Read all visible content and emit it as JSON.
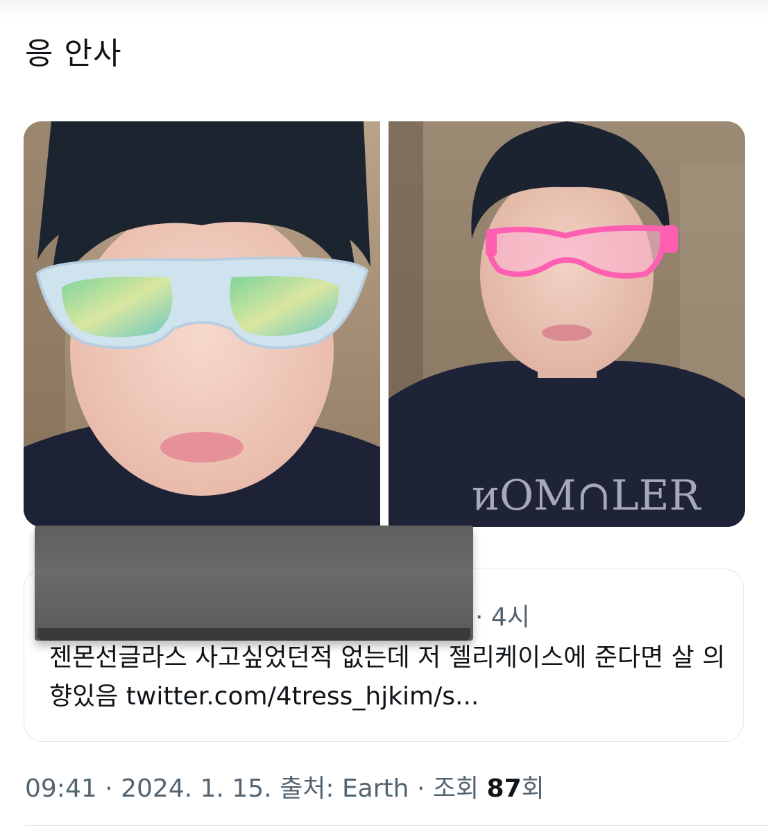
{
  "tweet": {
    "text": "응 안사"
  },
  "media": {
    "photos": [
      {
        "alt_name": "photo-left",
        "glasses_color": "#cfe3ee"
      },
      {
        "alt_name": "photo-right",
        "glasses_color": "#ff5fb0"
      }
    ]
  },
  "quote": {
    "time_sep": "·",
    "time": "4시",
    "body": "젠몬선글라스 사고싶었던적 없는데 저 젤리케이스에 준다면 살 의향있음 twitter.com/4tress_hjkim/s..."
  },
  "meta": {
    "time": "09:41",
    "date": "2024. 1. 15.",
    "source_label": "출처:",
    "source": "Earth",
    "views_label": "조회",
    "views_count": "87",
    "views_suffix": "회",
    "sep": "·"
  },
  "colors": {
    "text": "#0f1419",
    "muted": "#536471",
    "border": "#e1e6ea"
  }
}
